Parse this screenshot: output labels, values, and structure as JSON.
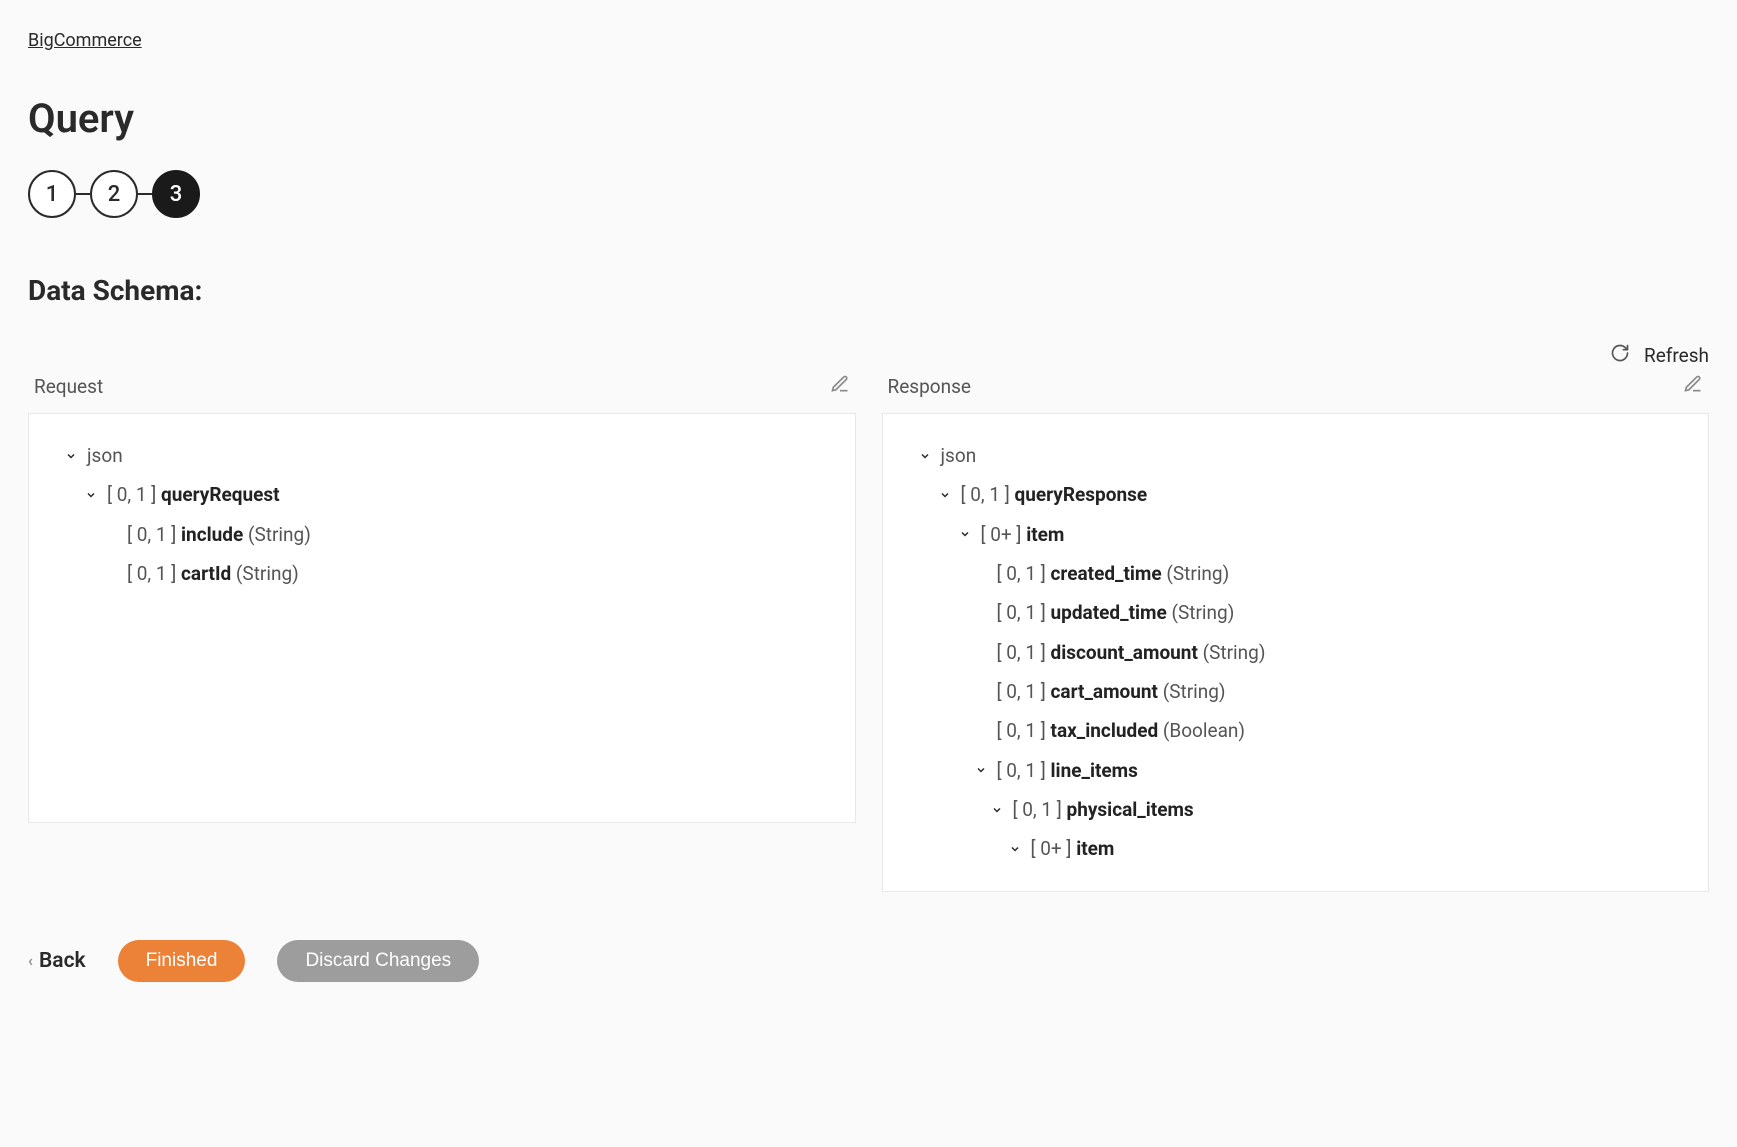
{
  "breadcrumb": "BigCommerce",
  "page_title": "Query",
  "stepper": {
    "steps": [
      "1",
      "2",
      "3"
    ],
    "active": 2
  },
  "section_title": "Data Schema:",
  "refresh_label": "Refresh",
  "request": {
    "label": "Request",
    "tree": [
      {
        "indent": 0,
        "exp": true,
        "card": "",
        "name": "json",
        "type": "",
        "plain": true
      },
      {
        "indent": 1,
        "exp": true,
        "card": "[ 0, 1 ]",
        "name": "queryRequest",
        "type": ""
      },
      {
        "indent": 2,
        "exp": null,
        "card": "[ 0, 1 ]",
        "name": "include",
        "type": "(String)"
      },
      {
        "indent": 2,
        "exp": null,
        "card": "[ 0, 1 ]",
        "name": "cartId",
        "type": "(String)"
      }
    ]
  },
  "response": {
    "label": "Response",
    "tree": [
      {
        "indent": 0,
        "exp": true,
        "card": "",
        "name": "json",
        "type": "",
        "plain": true
      },
      {
        "indent": 1,
        "exp": true,
        "card": "[ 0, 1 ]",
        "name": "queryResponse",
        "type": ""
      },
      {
        "indent": 2,
        "exp": true,
        "card": "[ 0+ ]",
        "name": "item",
        "type": ""
      },
      {
        "indent": 3,
        "exp": null,
        "card": "[ 0, 1 ]",
        "name": "created_time",
        "type": "(String)"
      },
      {
        "indent": 3,
        "exp": null,
        "card": "[ 0, 1 ]",
        "name": "updated_time",
        "type": "(String)"
      },
      {
        "indent": 3,
        "exp": null,
        "card": "[ 0, 1 ]",
        "name": "discount_amount",
        "type": "(String)"
      },
      {
        "indent": 3,
        "exp": null,
        "card": "[ 0, 1 ]",
        "name": "cart_amount",
        "type": "(String)"
      },
      {
        "indent": 3,
        "exp": null,
        "card": "[ 0, 1 ]",
        "name": "tax_included",
        "type": "(Boolean)"
      },
      {
        "indent": 3,
        "exp": true,
        "card": "[ 0, 1 ]",
        "name": "line_items",
        "type": ""
      },
      {
        "indent": 4,
        "exp": true,
        "card": "[ 0, 1 ]",
        "name": "physical_items",
        "type": ""
      },
      {
        "indent": 5,
        "exp": true,
        "card": "[ 0+ ]",
        "name": "item",
        "type": ""
      }
    ]
  },
  "footer": {
    "back": "Back",
    "finished": "Finished",
    "discard": "Discard Changes"
  }
}
